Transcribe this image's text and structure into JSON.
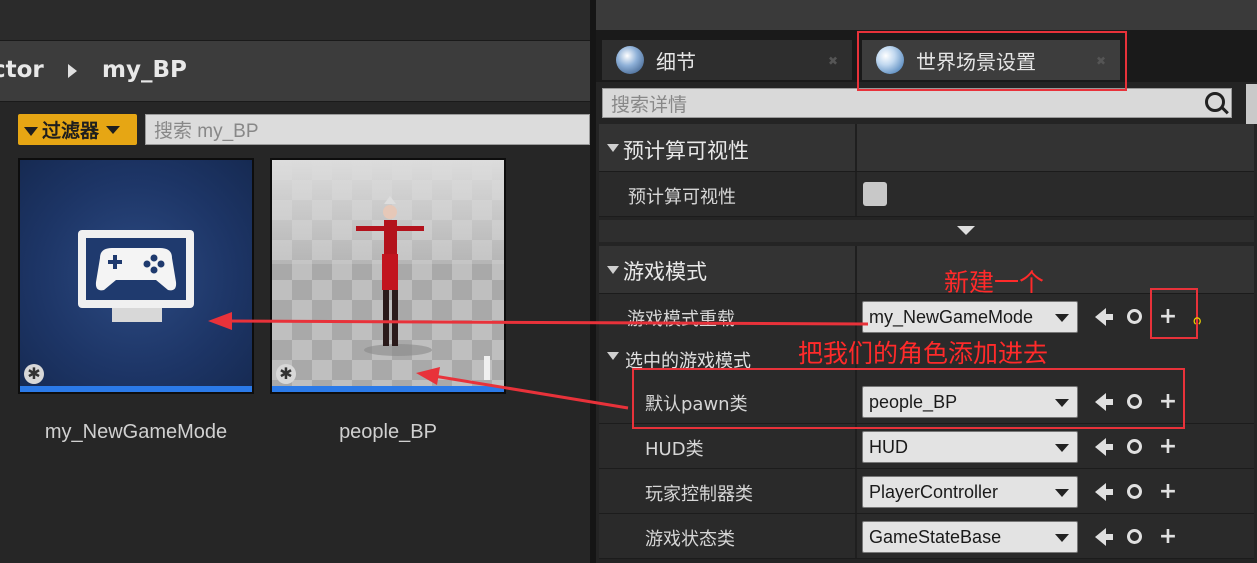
{
  "content_browser": {
    "breadcrumb": {
      "parent": "ctor",
      "current": "my_BP"
    },
    "filter_label": "过滤器",
    "search_placeholder": "搜索 my_BP",
    "assets": [
      {
        "name": "my_NewGameMode",
        "icon": "gamepad-monitor-icon"
      },
      {
        "name": "people_BP",
        "icon": "character-thumbnail"
      }
    ]
  },
  "details": {
    "tabs": [
      {
        "label": "细节",
        "icon": "magnifier-info-icon"
      },
      {
        "label": "世界场景设置",
        "icon": "globe-icon"
      }
    ],
    "search_placeholder": "搜索详情",
    "sections": {
      "precomputed": {
        "title": "预计算可视性",
        "prop_label": "预计算可视性"
      },
      "game_mode": {
        "title": "游戏模式",
        "override_label": "游戏模式重载",
        "override_value": "my_NewGameMode",
        "selected_title": "选中的游戏模式",
        "props": [
          {
            "label": "默认pawn类",
            "value": "people_BP"
          },
          {
            "label": "HUD类",
            "value": "HUD"
          },
          {
            "label": "玩家控制器类",
            "value": "PlayerController"
          },
          {
            "label": "游戏状态类",
            "value": "GameStateBase"
          }
        ]
      }
    }
  },
  "annotations": {
    "new_one": "新建一个",
    "add_character": "把我们的角色添加进去"
  },
  "colors": {
    "accent_filter": "#e6a614",
    "annotation_red": "#ff2a2a",
    "thumbnail_bar": "#2b7ae8"
  }
}
